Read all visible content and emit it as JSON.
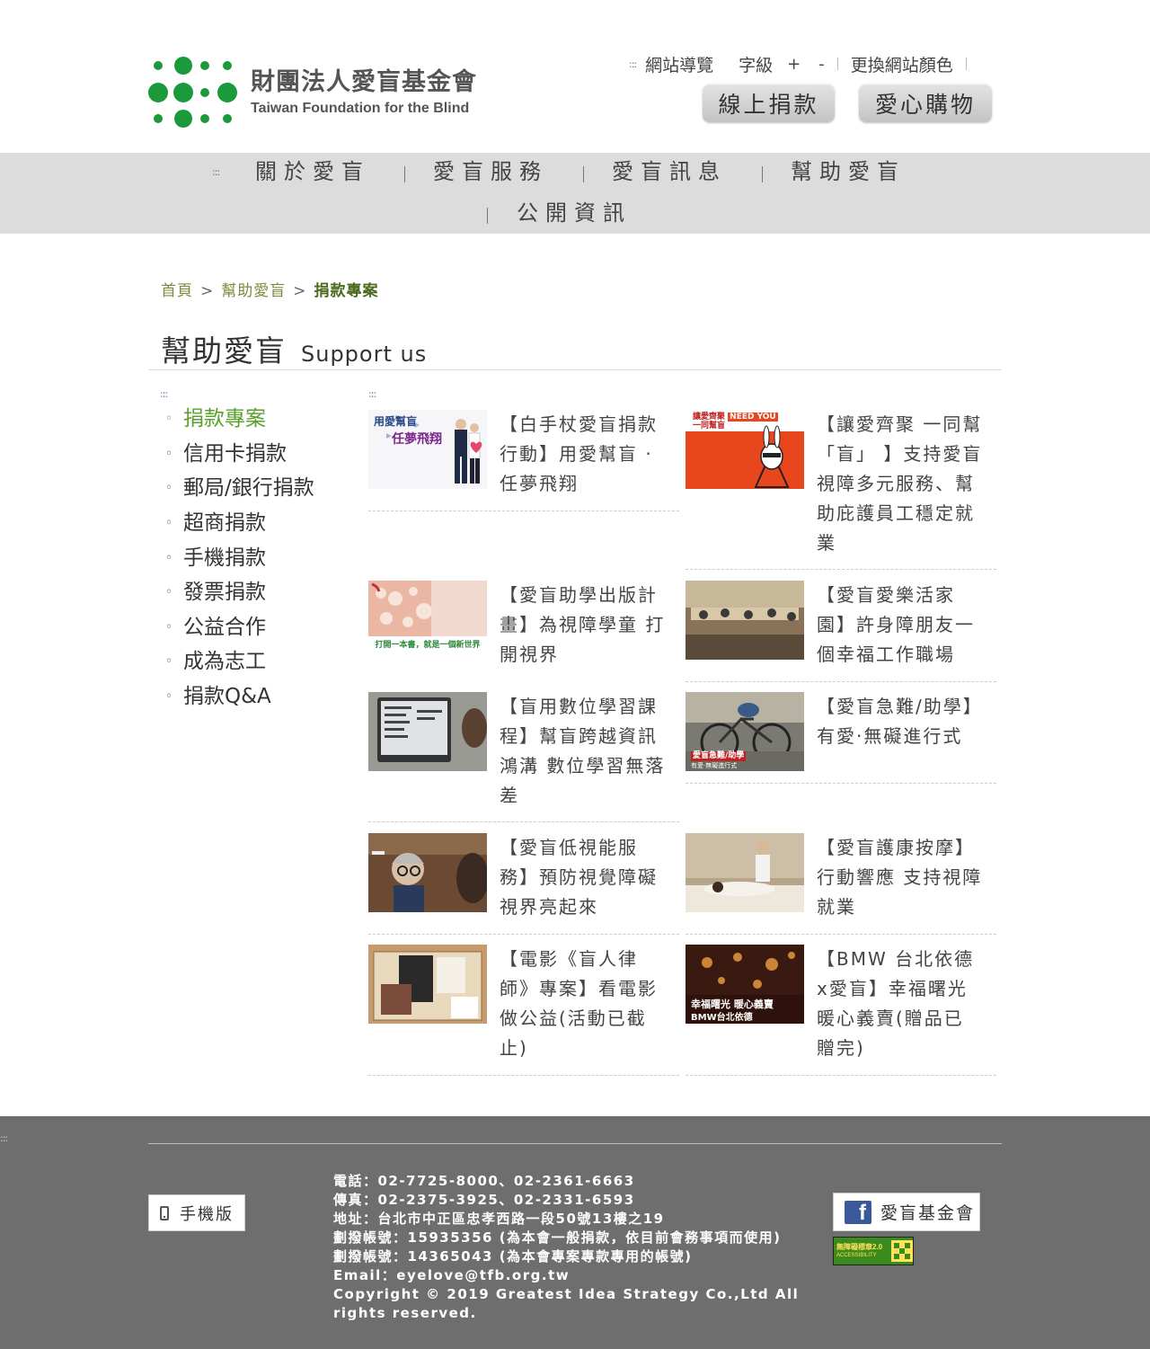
{
  "header": {
    "org_name_zh": "財團法人愛盲基金會",
    "org_name_en": "Taiwan Foundation for the Blind",
    "accesskey_marker": ":::",
    "site_map": "網站導覽",
    "font_size_label": "字級",
    "font_plus": "+",
    "font_minus": "-",
    "change_color": "更換網站顏色",
    "donate_button": "線上捐款",
    "shop_button": "愛心購物"
  },
  "main_nav": {
    "accesskey_marker": ":::",
    "items": [
      "關於愛盲",
      "愛盲服務",
      "愛盲訊息",
      "幫助愛盲",
      "公開資訊"
    ]
  },
  "breadcrumb": {
    "home": "首頁",
    "parent": "幫助愛盲",
    "current": "捐款專案",
    "separator": ">"
  },
  "page_title": {
    "zh": "幫助愛盲",
    "en": "Support us"
  },
  "side_menu": {
    "accesskey_marker": ":::",
    "bullet": "◦",
    "items": [
      {
        "label": "捐款專案",
        "active": true
      },
      {
        "label": "信用卡捐款",
        "active": false
      },
      {
        "label": "郵局/銀行捐款",
        "active": false
      },
      {
        "label": "超商捐款",
        "active": false
      },
      {
        "label": "手機捐款",
        "active": false
      },
      {
        "label": "發票捐款",
        "active": false
      },
      {
        "label": "公益合作",
        "active": false
      },
      {
        "label": "成為志工",
        "active": false
      },
      {
        "label": "捐款Q&A",
        "active": false
      }
    ]
  },
  "content": {
    "accesskey_marker": ":::",
    "projects": [
      {
        "title": "【白手杖愛盲捐款行動】用愛幫盲 · 任夢飛翔",
        "thumb_text": [
          "用愛幫盲",
          "任夢飛翔"
        ]
      },
      {
        "title": "【讓愛齊聚 一同幫「盲」 】支持愛盲視障多元服務、幫助庇護員工穩定就業",
        "thumb_text": [
          "讓愛齊聚",
          "一同幫盲",
          "NEED YOU"
        ]
      },
      {
        "title": "【愛盲助學出版計畫】為視障學童 打開視界",
        "thumb_text": [
          "打開一本書，就是一個新世界"
        ]
      },
      {
        "title": "【愛盲愛樂活家園】許身障朋友一個幸福工作職場",
        "thumb_text": []
      },
      {
        "title": "【盲用數位學習課程】幫盲跨越資訊鴻溝 數位學習無落差",
        "thumb_text": []
      },
      {
        "title": "【愛盲急難/助學】有愛·無礙進行式",
        "thumb_text": [
          "愛盲急難/助學",
          "有愛·無礙進行式"
        ]
      },
      {
        "title": "【愛盲低視能服務】預防視覺障礙 視界亮起來",
        "thumb_text": []
      },
      {
        "title": "【愛盲護康按摩】行動響應 支持視障就業",
        "thumb_text": []
      },
      {
        "title": "【電影《盲人律師》專案】看電影做公益(活動已截止)",
        "thumb_text": []
      },
      {
        "title": "【BMW 台北依德x愛盲】幸福曙光 暖心義賣(贈品已贈完)",
        "thumb_text": [
          "幸福曙光 暖心義賣",
          "BMW台北依德"
        ]
      }
    ]
  },
  "footer": {
    "accesskey_marker": ":::",
    "mobile_button": "手機版",
    "contact_lines": [
      "電話：02-7725-8000、02-2361-6663",
      "傳真：02-2375-3925、02-2331-6593",
      "地址：台北市中正區忠孝西路一段50號13樓之19",
      "劃撥帳號：15935356 (為本會一般捐款，依目前會務事項而使用)",
      "劃撥帳號：14365043 (為本會專案專款專用的帳號)",
      "Email：eyelove@tfb.org.tw",
      "Copyright © 2019 Greatest Idea Strategy Co.,Ltd All rights reserved."
    ],
    "facebook_label": "愛盲基金會",
    "facebook_icon": "f",
    "a11y_badge": {
      "label": "無障礙標章2.0",
      "sub": "ACCESSIBILITY"
    }
  },
  "colors": {
    "brand_green": "#1a9a3a",
    "active_menu": "#5aa02c",
    "breadcrumb": "#7a8c3c",
    "nav_bg": "#dcdcdc",
    "footer_bg": "#6e6e6e"
  }
}
